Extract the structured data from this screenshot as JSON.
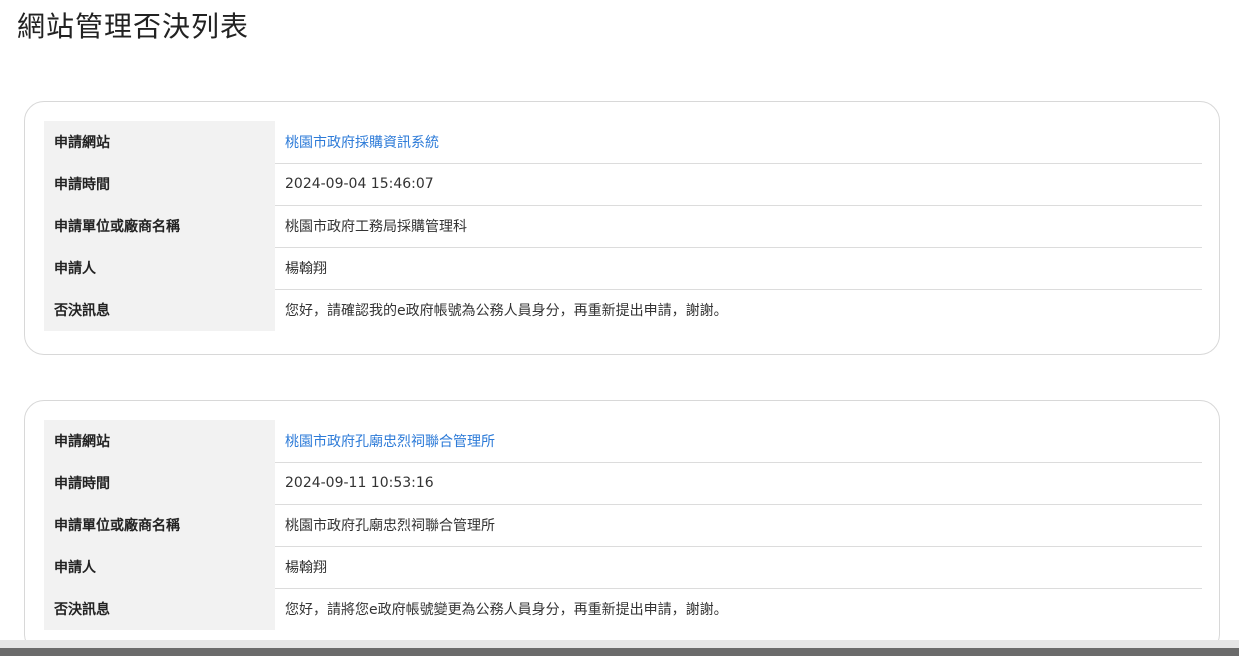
{
  "page": {
    "title": "網站管理否決列表"
  },
  "labels": {
    "site": "申請網站",
    "time": "申請時間",
    "unit": "申請單位或廠商名稱",
    "applicant": "申請人",
    "reason": "否決訊息"
  },
  "records": [
    {
      "site": "桃園市政府採購資訊系統",
      "time": "2024-09-04 15:46:07",
      "unit": "桃園市政府工務局採購管理科",
      "applicant": "楊翰翔",
      "reason": "您好，請確認我的e政府帳號為公務人員身分，再重新提出申請，謝謝。"
    },
    {
      "site": "桃園市政府孔廟忠烈祠聯合管理所",
      "time": "2024-09-11 10:53:16",
      "unit": "桃園市政府孔廟忠烈祠聯合管理所",
      "applicant": "楊翰翔",
      "reason": "您好，請將您e政府帳號變更為公務人員身分，再重新提出申請，謝謝。"
    }
  ],
  "colors": {
    "link": "#2d7bd8",
    "label_bg": "#f2f2f2",
    "card_border": "#d8d8d8"
  }
}
